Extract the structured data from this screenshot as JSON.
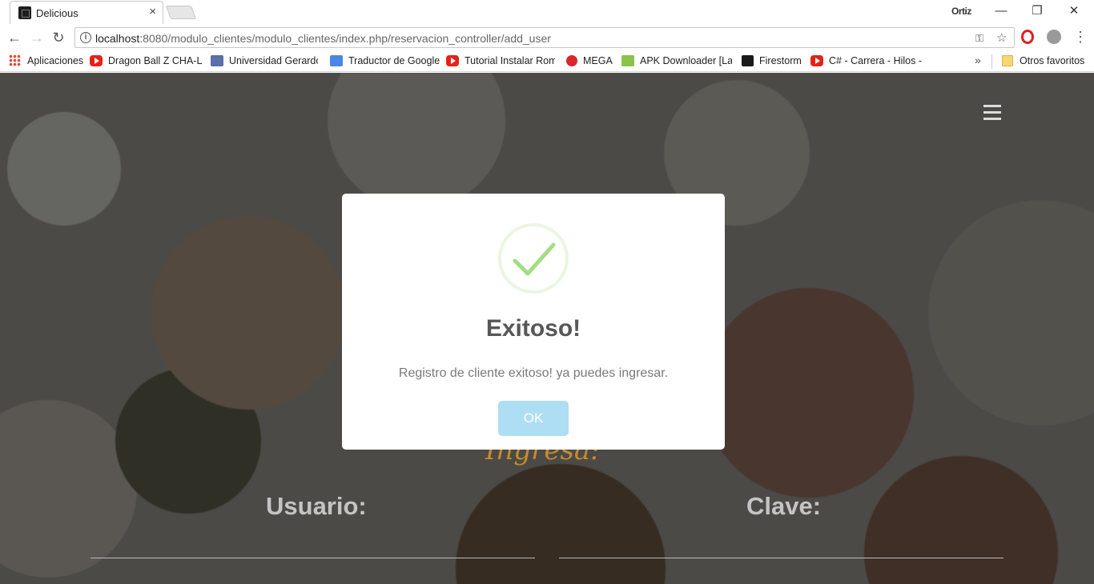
{
  "browser": {
    "tab_title": "Delicious",
    "tab_close": "×",
    "profile_name": "Ortiz",
    "window_controls": {
      "minimize": "—",
      "restore": "❐",
      "close": "✕"
    },
    "url_host": "localhost",
    "url_path": ":8080/modulo_clientes/modulo_clientes/index.php/reservacion_controller/add_user",
    "bookmarks": [
      {
        "label": "Aplicaciones",
        "icon": "apps-grid-icon"
      },
      {
        "label": "Dragon Ball Z CHA-L",
        "icon": "youtube-icon"
      },
      {
        "label": "Universidad Gerardo",
        "icon": "university-icon"
      },
      {
        "label": "Traductor de Google",
        "icon": "google-translate-icon"
      },
      {
        "label": "Tutorial Instalar Rom",
        "icon": "youtube-icon"
      },
      {
        "label": "MEGA",
        "icon": "mega-icon"
      },
      {
        "label": "APK Downloader [Lat",
        "icon": "apk-icon"
      },
      {
        "label": "Firestorm",
        "icon": "firestorm-icon"
      },
      {
        "label": "C# - Carrera - Hilos -",
        "icon": "youtube-icon"
      }
    ],
    "other_bookmarks": "Otros favoritos",
    "more_bookmarks": "»"
  },
  "page": {
    "form_heading": "Ingresa:",
    "user_label": "Usuario:",
    "password_label": "Clave:"
  },
  "modal": {
    "title": "Exitoso!",
    "message": "Registro de cliente exitoso! ya puedes ingresar.",
    "ok_label": "OK",
    "success_color": "#a5dc86",
    "button_color": "#aedef4"
  }
}
